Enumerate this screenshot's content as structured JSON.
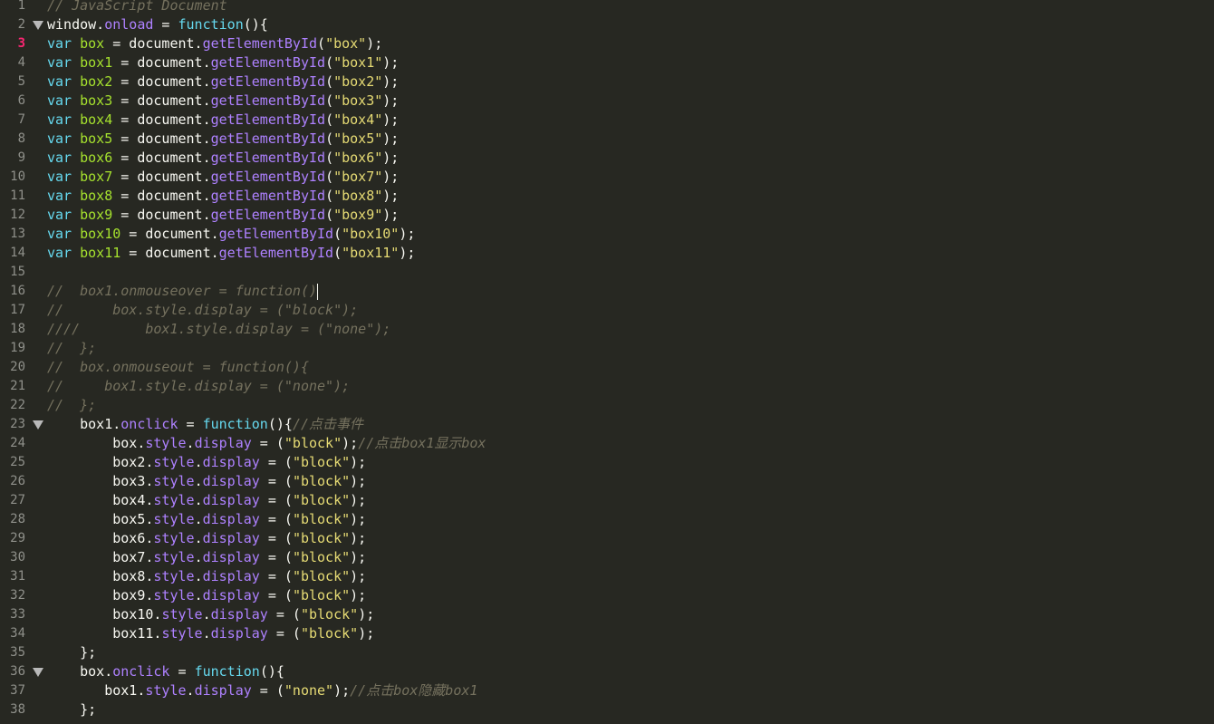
{
  "editor": {
    "active_line": 3,
    "caret_after_line": 16,
    "colors": {
      "background": "#272822",
      "text": "#f8f8f2",
      "keyword": "#66d9ef",
      "identifier": "#a6e22e",
      "property": "#ae81ff",
      "string": "#e6db74",
      "comment": "#75715e",
      "active_line_number": "#f92672"
    },
    "lines": [
      {
        "n": "1",
        "tokens": [
          {
            "t": "// JavaScript Document",
            "c": "cmt"
          }
        ]
      },
      {
        "n": "2",
        "fold": true,
        "tokens": [
          {
            "t": "window.",
            "c": "text"
          },
          {
            "t": "onload",
            "c": "fn"
          },
          {
            "t": " = ",
            "c": "text"
          },
          {
            "t": "function",
            "c": "kw"
          },
          {
            "t": "(){",
            "c": "text"
          }
        ]
      },
      {
        "n": "3",
        "tokens": [
          {
            "t": "var",
            "c": "kw"
          },
          {
            "t": " ",
            "c": "text"
          },
          {
            "t": "box",
            "c": "id"
          },
          {
            "t": " = document.",
            "c": "text"
          },
          {
            "t": "getElementById",
            "c": "fn"
          },
          {
            "t": "(",
            "c": "text"
          },
          {
            "t": "\"box\"",
            "c": "str"
          },
          {
            "t": ");",
            "c": "text"
          }
        ]
      },
      {
        "n": "4",
        "tokens": [
          {
            "t": "var",
            "c": "kw"
          },
          {
            "t": " ",
            "c": "text"
          },
          {
            "t": "box1",
            "c": "id"
          },
          {
            "t": " = document.",
            "c": "text"
          },
          {
            "t": "getElementById",
            "c": "fn"
          },
          {
            "t": "(",
            "c": "text"
          },
          {
            "t": "\"box1\"",
            "c": "str"
          },
          {
            "t": ");",
            "c": "text"
          }
        ]
      },
      {
        "n": "5",
        "tokens": [
          {
            "t": "var",
            "c": "kw"
          },
          {
            "t": " ",
            "c": "text"
          },
          {
            "t": "box2",
            "c": "id"
          },
          {
            "t": " = document.",
            "c": "text"
          },
          {
            "t": "getElementById",
            "c": "fn"
          },
          {
            "t": "(",
            "c": "text"
          },
          {
            "t": "\"box2\"",
            "c": "str"
          },
          {
            "t": ");",
            "c": "text"
          }
        ]
      },
      {
        "n": "6",
        "tokens": [
          {
            "t": "var",
            "c": "kw"
          },
          {
            "t": " ",
            "c": "text"
          },
          {
            "t": "box3",
            "c": "id"
          },
          {
            "t": " = document.",
            "c": "text"
          },
          {
            "t": "getElementById",
            "c": "fn"
          },
          {
            "t": "(",
            "c": "text"
          },
          {
            "t": "\"box3\"",
            "c": "str"
          },
          {
            "t": ");",
            "c": "text"
          }
        ]
      },
      {
        "n": "7",
        "tokens": [
          {
            "t": "var",
            "c": "kw"
          },
          {
            "t": " ",
            "c": "text"
          },
          {
            "t": "box4",
            "c": "id"
          },
          {
            "t": " = document.",
            "c": "text"
          },
          {
            "t": "getElementById",
            "c": "fn"
          },
          {
            "t": "(",
            "c": "text"
          },
          {
            "t": "\"box4\"",
            "c": "str"
          },
          {
            "t": ");",
            "c": "text"
          }
        ]
      },
      {
        "n": "8",
        "tokens": [
          {
            "t": "var",
            "c": "kw"
          },
          {
            "t": " ",
            "c": "text"
          },
          {
            "t": "box5",
            "c": "id"
          },
          {
            "t": " = document.",
            "c": "text"
          },
          {
            "t": "getElementById",
            "c": "fn"
          },
          {
            "t": "(",
            "c": "text"
          },
          {
            "t": "\"box5\"",
            "c": "str"
          },
          {
            "t": ");",
            "c": "text"
          }
        ]
      },
      {
        "n": "9",
        "tokens": [
          {
            "t": "var",
            "c": "kw"
          },
          {
            "t": " ",
            "c": "text"
          },
          {
            "t": "box6",
            "c": "id"
          },
          {
            "t": " = document.",
            "c": "text"
          },
          {
            "t": "getElementById",
            "c": "fn"
          },
          {
            "t": "(",
            "c": "text"
          },
          {
            "t": "\"box6\"",
            "c": "str"
          },
          {
            "t": ");",
            "c": "text"
          }
        ]
      },
      {
        "n": "10",
        "tokens": [
          {
            "t": "var",
            "c": "kw"
          },
          {
            "t": " ",
            "c": "text"
          },
          {
            "t": "box7",
            "c": "id"
          },
          {
            "t": " = document.",
            "c": "text"
          },
          {
            "t": "getElementById",
            "c": "fn"
          },
          {
            "t": "(",
            "c": "text"
          },
          {
            "t": "\"box7\"",
            "c": "str"
          },
          {
            "t": ");",
            "c": "text"
          }
        ]
      },
      {
        "n": "11",
        "tokens": [
          {
            "t": "var",
            "c": "kw"
          },
          {
            "t": " ",
            "c": "text"
          },
          {
            "t": "box8",
            "c": "id"
          },
          {
            "t": " = document.",
            "c": "text"
          },
          {
            "t": "getElementById",
            "c": "fn"
          },
          {
            "t": "(",
            "c": "text"
          },
          {
            "t": "\"box8\"",
            "c": "str"
          },
          {
            "t": ");",
            "c": "text"
          }
        ]
      },
      {
        "n": "12",
        "tokens": [
          {
            "t": "var",
            "c": "kw"
          },
          {
            "t": " ",
            "c": "text"
          },
          {
            "t": "box9",
            "c": "id"
          },
          {
            "t": " = document.",
            "c": "text"
          },
          {
            "t": "getElementById",
            "c": "fn"
          },
          {
            "t": "(",
            "c": "text"
          },
          {
            "t": "\"box9\"",
            "c": "str"
          },
          {
            "t": ");",
            "c": "text"
          }
        ]
      },
      {
        "n": "13",
        "tokens": [
          {
            "t": "var",
            "c": "kw"
          },
          {
            "t": " ",
            "c": "text"
          },
          {
            "t": "box10",
            "c": "id"
          },
          {
            "t": " = document.",
            "c": "text"
          },
          {
            "t": "getElementById",
            "c": "fn"
          },
          {
            "t": "(",
            "c": "text"
          },
          {
            "t": "\"box10\"",
            "c": "str"
          },
          {
            "t": ");",
            "c": "text"
          }
        ]
      },
      {
        "n": "14",
        "tokens": [
          {
            "t": "var",
            "c": "kw"
          },
          {
            "t": " ",
            "c": "text"
          },
          {
            "t": "box11",
            "c": "id"
          },
          {
            "t": " = document.",
            "c": "text"
          },
          {
            "t": "getElementById",
            "c": "fn"
          },
          {
            "t": "(",
            "c": "text"
          },
          {
            "t": "\"box11\"",
            "c": "str"
          },
          {
            "t": ");",
            "c": "text"
          }
        ]
      },
      {
        "n": "15",
        "tokens": []
      },
      {
        "n": "16",
        "tokens": [
          {
            "t": "//  box1.onmouseover = function()",
            "c": "cmt"
          }
        ]
      },
      {
        "n": "17",
        "tokens": [
          {
            "t": "//      box.style.display = (\"block\");",
            "c": "cmt"
          }
        ]
      },
      {
        "n": "18",
        "tokens": [
          {
            "t": "////        box1.style.display = (\"none\");",
            "c": "cmt"
          }
        ]
      },
      {
        "n": "19",
        "tokens": [
          {
            "t": "//  };",
            "c": "cmt"
          }
        ]
      },
      {
        "n": "20",
        "tokens": [
          {
            "t": "//  box.onmouseout = function(){",
            "c": "cmt"
          }
        ]
      },
      {
        "n": "21",
        "tokens": [
          {
            "t": "//     box1.style.display = (\"none\");",
            "c": "cmt"
          }
        ]
      },
      {
        "n": "22",
        "tokens": [
          {
            "t": "//  };",
            "c": "cmt"
          }
        ]
      },
      {
        "n": "23",
        "fold": true,
        "tokens": [
          {
            "t": "    box1.",
            "c": "text"
          },
          {
            "t": "onclick",
            "c": "fn"
          },
          {
            "t": " = ",
            "c": "text"
          },
          {
            "t": "function",
            "c": "kw"
          },
          {
            "t": "(){",
            "c": "text"
          },
          {
            "t": "//点击事件",
            "c": "cmt"
          }
        ]
      },
      {
        "n": "24",
        "tokens": [
          {
            "t": "        box.",
            "c": "text"
          },
          {
            "t": "style",
            "c": "fn"
          },
          {
            "t": ".",
            "c": "text"
          },
          {
            "t": "display",
            "c": "fn"
          },
          {
            "t": " = (",
            "c": "text"
          },
          {
            "t": "\"block\"",
            "c": "str"
          },
          {
            "t": ");",
            "c": "text"
          },
          {
            "t": "//点击box1显示box",
            "c": "cmt"
          }
        ]
      },
      {
        "n": "25",
        "tokens": [
          {
            "t": "        box2.",
            "c": "text"
          },
          {
            "t": "style",
            "c": "fn"
          },
          {
            "t": ".",
            "c": "text"
          },
          {
            "t": "display",
            "c": "fn"
          },
          {
            "t": " = (",
            "c": "text"
          },
          {
            "t": "\"block\"",
            "c": "str"
          },
          {
            "t": ");",
            "c": "text"
          }
        ]
      },
      {
        "n": "26",
        "tokens": [
          {
            "t": "        box3.",
            "c": "text"
          },
          {
            "t": "style",
            "c": "fn"
          },
          {
            "t": ".",
            "c": "text"
          },
          {
            "t": "display",
            "c": "fn"
          },
          {
            "t": " = (",
            "c": "text"
          },
          {
            "t": "\"block\"",
            "c": "str"
          },
          {
            "t": ");",
            "c": "text"
          }
        ]
      },
      {
        "n": "27",
        "tokens": [
          {
            "t": "        box4.",
            "c": "text"
          },
          {
            "t": "style",
            "c": "fn"
          },
          {
            "t": ".",
            "c": "text"
          },
          {
            "t": "display",
            "c": "fn"
          },
          {
            "t": " = (",
            "c": "text"
          },
          {
            "t": "\"block\"",
            "c": "str"
          },
          {
            "t": ");",
            "c": "text"
          }
        ]
      },
      {
        "n": "28",
        "tokens": [
          {
            "t": "        box5.",
            "c": "text"
          },
          {
            "t": "style",
            "c": "fn"
          },
          {
            "t": ".",
            "c": "text"
          },
          {
            "t": "display",
            "c": "fn"
          },
          {
            "t": " = (",
            "c": "text"
          },
          {
            "t": "\"block\"",
            "c": "str"
          },
          {
            "t": ");",
            "c": "text"
          }
        ]
      },
      {
        "n": "29",
        "tokens": [
          {
            "t": "        box6.",
            "c": "text"
          },
          {
            "t": "style",
            "c": "fn"
          },
          {
            "t": ".",
            "c": "text"
          },
          {
            "t": "display",
            "c": "fn"
          },
          {
            "t": " = (",
            "c": "text"
          },
          {
            "t": "\"block\"",
            "c": "str"
          },
          {
            "t": ");",
            "c": "text"
          }
        ]
      },
      {
        "n": "30",
        "tokens": [
          {
            "t": "        box7.",
            "c": "text"
          },
          {
            "t": "style",
            "c": "fn"
          },
          {
            "t": ".",
            "c": "text"
          },
          {
            "t": "display",
            "c": "fn"
          },
          {
            "t": " = (",
            "c": "text"
          },
          {
            "t": "\"block\"",
            "c": "str"
          },
          {
            "t": ");",
            "c": "text"
          }
        ]
      },
      {
        "n": "31",
        "tokens": [
          {
            "t": "        box8.",
            "c": "text"
          },
          {
            "t": "style",
            "c": "fn"
          },
          {
            "t": ".",
            "c": "text"
          },
          {
            "t": "display",
            "c": "fn"
          },
          {
            "t": " = (",
            "c": "text"
          },
          {
            "t": "\"block\"",
            "c": "str"
          },
          {
            "t": ");",
            "c": "text"
          }
        ]
      },
      {
        "n": "32",
        "tokens": [
          {
            "t": "        box9.",
            "c": "text"
          },
          {
            "t": "style",
            "c": "fn"
          },
          {
            "t": ".",
            "c": "text"
          },
          {
            "t": "display",
            "c": "fn"
          },
          {
            "t": " = (",
            "c": "text"
          },
          {
            "t": "\"block\"",
            "c": "str"
          },
          {
            "t": ");",
            "c": "text"
          }
        ]
      },
      {
        "n": "33",
        "tokens": [
          {
            "t": "        box10.",
            "c": "text"
          },
          {
            "t": "style",
            "c": "fn"
          },
          {
            "t": ".",
            "c": "text"
          },
          {
            "t": "display",
            "c": "fn"
          },
          {
            "t": " = (",
            "c": "text"
          },
          {
            "t": "\"block\"",
            "c": "str"
          },
          {
            "t": ");",
            "c": "text"
          }
        ]
      },
      {
        "n": "34",
        "tokens": [
          {
            "t": "        box11.",
            "c": "text"
          },
          {
            "t": "style",
            "c": "fn"
          },
          {
            "t": ".",
            "c": "text"
          },
          {
            "t": "display",
            "c": "fn"
          },
          {
            "t": " = (",
            "c": "text"
          },
          {
            "t": "\"block\"",
            "c": "str"
          },
          {
            "t": ");",
            "c": "text"
          }
        ]
      },
      {
        "n": "35",
        "tokens": [
          {
            "t": "    };",
            "c": "text"
          }
        ]
      },
      {
        "n": "36",
        "fold": true,
        "tokens": [
          {
            "t": "    box.",
            "c": "text"
          },
          {
            "t": "onclick",
            "c": "fn"
          },
          {
            "t": " = ",
            "c": "text"
          },
          {
            "t": "function",
            "c": "kw"
          },
          {
            "t": "(){",
            "c": "text"
          }
        ]
      },
      {
        "n": "37",
        "tokens": [
          {
            "t": "       box1.",
            "c": "text"
          },
          {
            "t": "style",
            "c": "fn"
          },
          {
            "t": ".",
            "c": "text"
          },
          {
            "t": "display",
            "c": "fn"
          },
          {
            "t": " = (",
            "c": "text"
          },
          {
            "t": "\"none\"",
            "c": "str"
          },
          {
            "t": ");",
            "c": "text"
          },
          {
            "t": "//点击box隐藏box1",
            "c": "cmt"
          }
        ]
      },
      {
        "n": "38",
        "tokens": [
          {
            "t": "    };",
            "c": "text"
          }
        ]
      }
    ]
  }
}
